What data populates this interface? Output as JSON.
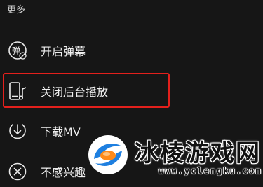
{
  "header": {
    "title": "更多"
  },
  "menu": {
    "items": [
      {
        "label": "开启弹幕",
        "icon": "danmaku-icon",
        "icon_text": "弹"
      },
      {
        "label": "关闭后台播放",
        "icon": "phone-music-icon"
      },
      {
        "label": "下载MV",
        "icon": "download-icon"
      },
      {
        "label": "不感兴趣",
        "icon": "close-circle-icon"
      }
    ]
  },
  "watermark": {
    "title": "冰棱游戏网",
    "url": "www.yclengku.com",
    "logo": "watermark-logo"
  },
  "colors": {
    "background": "#161616",
    "highlight": "#e3201c",
    "logo_blue": "#1e7fe0",
    "logo_orange": "#ff8a1a"
  }
}
